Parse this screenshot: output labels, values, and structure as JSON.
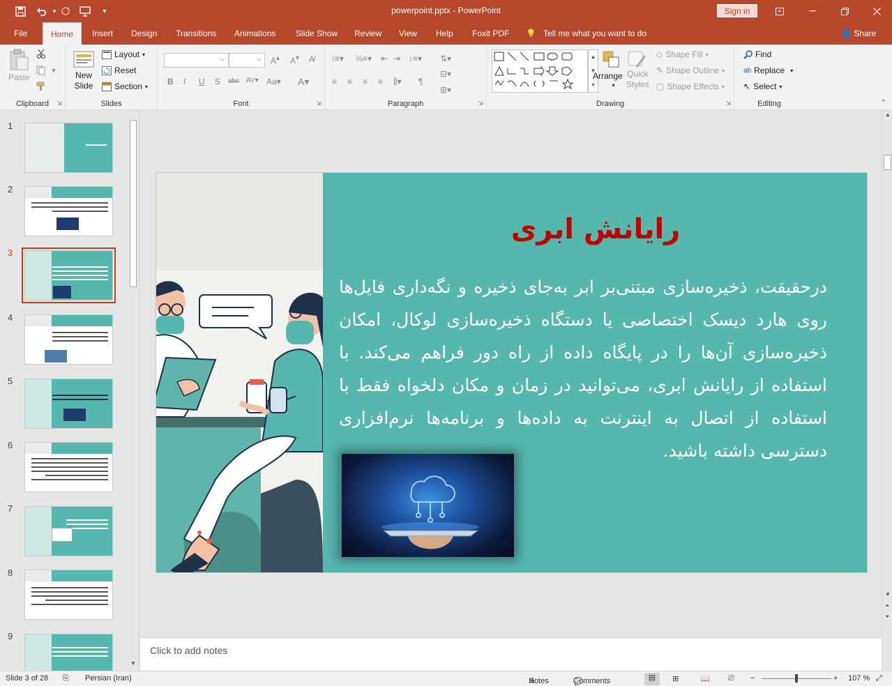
{
  "window": {
    "title": "powerpoint.pptx  -  PowerPoint",
    "signin_label": "Sign in"
  },
  "tabs": [
    "File",
    "Home",
    "Insert",
    "Design",
    "Transitions",
    "Animations",
    "Slide Show",
    "Review",
    "View",
    "Help",
    "Foxit PDF"
  ],
  "active_tab": "Home",
  "tell_me": "Tell me what you want to do",
  "share_label": "Share",
  "ribbon": {
    "clipboard": {
      "paste": "Paste",
      "label": "Clipboard"
    },
    "slides": {
      "new_slide_1": "New",
      "new_slide_2": "Slide",
      "layout": "Layout",
      "reset": "Reset",
      "section": "Section",
      "label": "Slides"
    },
    "font": {
      "label": "Font"
    },
    "paragraph": {
      "label": "Paragraph"
    },
    "drawing": {
      "arrange": "Arrange",
      "quick_styles_1": "Quick",
      "quick_styles_2": "Styles",
      "shape_fill": "Shape Fill",
      "shape_outline": "Shape Outline",
      "shape_effects": "Shape Effects",
      "label": "Drawing"
    },
    "editing": {
      "find": "Find",
      "replace": "Replace",
      "select": "Select",
      "label": "Editing"
    }
  },
  "thumbnails": [
    {
      "num": "1"
    },
    {
      "num": "2"
    },
    {
      "num": "3"
    },
    {
      "num": "4"
    },
    {
      "num": "5"
    },
    {
      "num": "6"
    },
    {
      "num": "7"
    },
    {
      "num": "8"
    },
    {
      "num": "9"
    }
  ],
  "selected_slide": 3,
  "slide": {
    "title": "رایانش ابری",
    "body": "درحقیقت، ذخیره‌سازی مبتنی‌بر ابر به‌جای ذخیره و نگه‌داری فایل‌ها روی هارد دیسک اختصاصی یا دستگاه ذخیره‌سازی لوکال، امکان ذخیره‌سازی آن‌ها را در پایگاه داده از راه دور فراهم می‌کند. با استفاده از رایانش ابری، می‌توانید در زمان و مکان دلخواه فقط با استفاده از اتصال به اینترنت به داده‌ها و برنامه‌ها نرم‌افزاری دسترسی داشته باشید."
  },
  "notes_placeholder": "Click to add notes",
  "status": {
    "slide_counter": "Slide 3 of 28",
    "language": "Persian (Iran)",
    "notes": "Notes",
    "comments": "Comments",
    "zoom": "107 %"
  },
  "colors": {
    "brand": "#b7472a",
    "slide_bg": "#56b7ad",
    "title_red": "#c00000"
  }
}
